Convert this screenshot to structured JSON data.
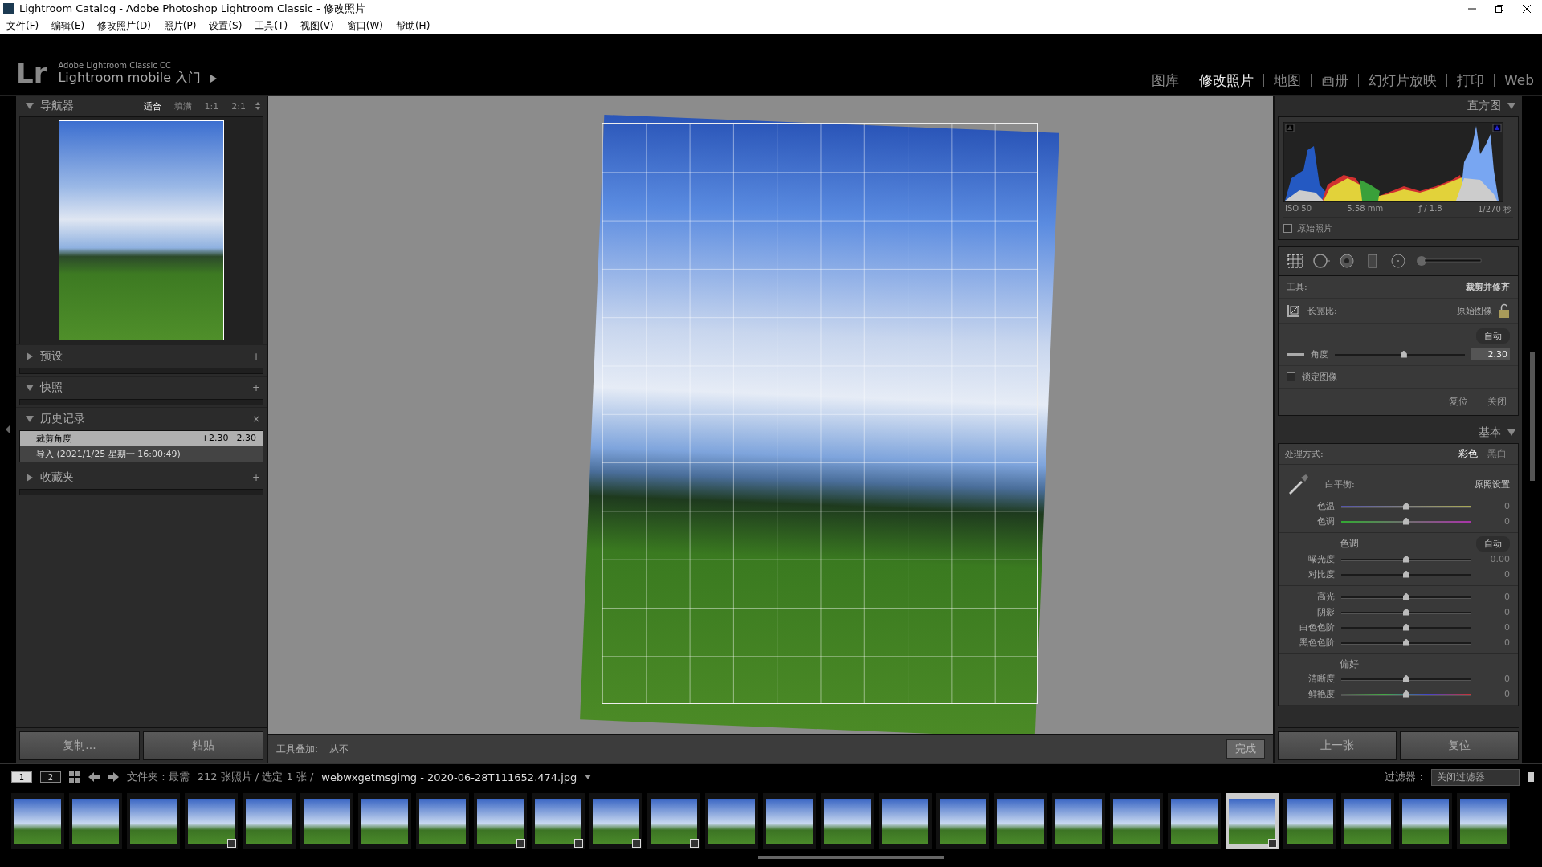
{
  "window": {
    "title": "Lightroom Catalog - Adobe Photoshop Lightroom Classic - 修改照片"
  },
  "menu": [
    "文件(F)",
    "编辑(E)",
    "修改照片(D)",
    "照片(P)",
    "设置(S)",
    "工具(T)",
    "视图(V)",
    "窗口(W)",
    "帮助(H)"
  ],
  "identity": {
    "logo": "Lr",
    "product": "Adobe Lightroom Classic CC",
    "mobile": "Lightroom mobile 入门"
  },
  "modules": [
    {
      "label": "图库",
      "selected": false
    },
    {
      "label": "修改照片",
      "selected": true
    },
    {
      "label": "地图",
      "selected": false
    },
    {
      "label": "画册",
      "selected": false
    },
    {
      "label": "幻灯片放映",
      "selected": false
    },
    {
      "label": "打印",
      "selected": false
    },
    {
      "label": "Web",
      "selected": false
    }
  ],
  "left_panel": {
    "navigator": {
      "title": "导航器",
      "expanded": true,
      "zoom_options": [
        {
          "label": "适合",
          "selected": true
        },
        {
          "label": "填满",
          "selected": false
        },
        {
          "label": "1:1",
          "selected": false
        },
        {
          "label": "2:1",
          "selected": false
        }
      ]
    },
    "sections": [
      {
        "title": "预设",
        "expanded": false,
        "action": "+"
      },
      {
        "title": "快照",
        "expanded": true,
        "action": "+"
      },
      {
        "title": "历史记录",
        "expanded": true,
        "action": "×",
        "history": [
          {
            "name": "裁剪角度",
            "from": "+2.30",
            "to": "2.30",
            "selected": true
          },
          {
            "name": "导入 (2021/1/25 星期一 16:00:49)",
            "selected": false
          }
        ]
      },
      {
        "title": "收藏夹",
        "expanded": false,
        "action": "+"
      }
    ],
    "buttons": [
      "复制...",
      "粘贴"
    ]
  },
  "toolbar": {
    "overlay_label": "工具叠加:",
    "overlay_value": "从不",
    "done": "完成"
  },
  "right_panel": {
    "histogram": {
      "title": "直方图",
      "expanded": true,
      "info": [
        "ISO 50",
        "5.58 mm",
        "ƒ / 1.8",
        "1/270 秒"
      ],
      "original_photo": {
        "label": "原始照片",
        "checked": false
      }
    },
    "tools": [
      {
        "kind": "crop",
        "selected": true
      },
      {
        "kind": "spot",
        "selected": false
      },
      {
        "kind": "redeye",
        "selected": false
      },
      {
        "kind": "graduated",
        "selected": false
      },
      {
        "kind": "radial",
        "selected": false
      },
      {
        "kind": "brush",
        "selected": false
      }
    ],
    "crop": {
      "tool_label": "工具:",
      "tool_name": "裁剪并修齐",
      "aspect_label": "长宽比:",
      "aspect_value": "原始图像",
      "locked": false,
      "auto": "自动",
      "angle_label": "角度",
      "angle_value": "2.30",
      "angle_slider": {
        "level": 0.53
      },
      "lock_image": {
        "label": "锁定图像",
        "checked": false
      },
      "reset": "复位",
      "close": "关闭"
    },
    "basic": {
      "title": "基本",
      "expanded": true,
      "treatment_label": "处理方式:",
      "treatments": [
        {
          "label": "彩色",
          "selected": true
        },
        {
          "label": "黑白",
          "selected": false
        }
      ],
      "wb_label": "白平衡:",
      "wb_value": "原照设置",
      "groups": [
        {
          "sliders": [
            {
              "label": "色温",
              "value": "0",
              "level": 0.5,
              "kind": "temp"
            },
            {
              "label": "色调",
              "value": "0",
              "level": 0.5,
              "kind": "tint"
            }
          ]
        },
        {
          "title": "色调",
          "auto": "自动",
          "sliders": [
            {
              "label": "曝光度",
              "value": "0.00",
              "level": 0.5,
              "kind": "plain"
            },
            {
              "label": "对比度",
              "value": "0",
              "level": 0.5,
              "kind": "plain"
            }
          ]
        },
        {
          "sliders": [
            {
              "label": "高光",
              "value": "0",
              "level": 0.5,
              "kind": "plain"
            },
            {
              "label": "阴影",
              "value": "0",
              "level": 0.5,
              "kind": "plain"
            },
            {
              "label": "白色色阶",
              "value": "0",
              "level": 0.5,
              "kind": "plain"
            },
            {
              "label": "黑色色阶",
              "value": "0",
              "level": 0.5,
              "kind": "plain"
            }
          ]
        },
        {
          "title": "偏好",
          "sliders": [
            {
              "label": "清晰度",
              "value": "0",
              "level": 0.5,
              "kind": "plain"
            },
            {
              "label": "鲜艳度",
              "value": "0",
              "level": 0.5,
              "kind": "vibrance"
            }
          ]
        }
      ]
    },
    "buttons": [
      "上一张",
      "复位"
    ]
  },
  "filmstrip": {
    "pages": [
      {
        "label": "1",
        "selected": true
      },
      {
        "label": "2",
        "selected": false
      }
    ],
    "source": "文件夹 : 最需",
    "count": "212 张照片 / 选定 1 张 /",
    "filename": "webwxgetmsgimg - 2020-06-28T111652.474.jpg",
    "filter_label": "过滤器 :",
    "filter_value": "关闭过滤器",
    "thumbs": [
      {
        "selected": false,
        "badge": false
      },
      {
        "selected": false,
        "badge": false
      },
      {
        "selected": false,
        "badge": false
      },
      {
        "selected": false,
        "badge": true
      },
      {
        "selected": false,
        "badge": false
      },
      {
        "selected": false,
        "badge": false
      },
      {
        "selected": false,
        "badge": false
      },
      {
        "selected": false,
        "badge": false
      },
      {
        "selected": false,
        "badge": true
      },
      {
        "selected": false,
        "badge": true
      },
      {
        "selected": false,
        "badge": true
      },
      {
        "selected": false,
        "badge": true
      },
      {
        "selected": false,
        "badge": false
      },
      {
        "selected": false,
        "badge": false
      },
      {
        "selected": false,
        "badge": false
      },
      {
        "selected": false,
        "badge": false
      },
      {
        "selected": false,
        "badge": false
      },
      {
        "selected": false,
        "badge": false
      },
      {
        "selected": false,
        "badge": false
      },
      {
        "selected": false,
        "badge": false
      },
      {
        "selected": false,
        "badge": false
      },
      {
        "selected": true,
        "badge": true
      },
      {
        "selected": false,
        "badge": false
      },
      {
        "selected": false,
        "badge": false
      },
      {
        "selected": false,
        "badge": false
      },
      {
        "selected": false,
        "badge": false
      }
    ]
  }
}
